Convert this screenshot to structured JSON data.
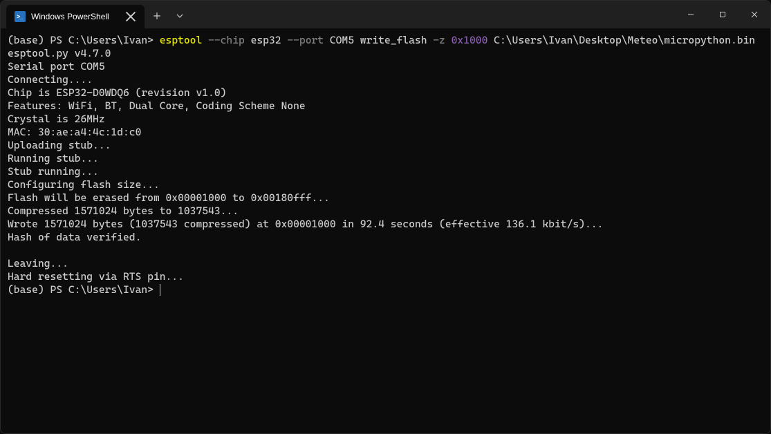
{
  "window": {
    "tab_title": "Windows PowerShell",
    "ps_icon_text": ">_"
  },
  "term": {
    "prompt_line": {
      "prefix": "(base) PS C:\\Users\\Ivan> ",
      "tool": "esptool",
      "seg1": " ",
      "flag1": "--chip",
      "seg2": " esp32 ",
      "flag2": "--port",
      "seg3": " COM5 write_flash ",
      "flag3": "-z",
      "seg4": " ",
      "addr": "0x1000",
      "seg5": " C:\\Users\\Ivan\\Desktop\\Meteo\\micropython.bin"
    },
    "out": [
      "esptool.py v4.7.0",
      "Serial port COM5",
      "Connecting....",
      "Chip is ESP32-D0WDQ6 (revision v1.0)",
      "Features: WiFi, BT, Dual Core, Coding Scheme None",
      "Crystal is 26MHz",
      "MAC: 30:ae:a4:4c:1d:c0",
      "Uploading stub...",
      "Running stub...",
      "Stub running...",
      "Configuring flash size...",
      "Flash will be erased from 0x00001000 to 0x00180fff...",
      "Compressed 1571024 bytes to 1037543...",
      "Wrote 1571024 bytes (1037543 compressed) at 0x00001000 in 92.4 seconds (effective 136.1 kbit/s)...",
      "Hash of data verified.",
      "",
      "Leaving...",
      "Hard resetting via RTS pin..."
    ],
    "final_prompt": "(base) PS C:\\Users\\Ivan> "
  }
}
